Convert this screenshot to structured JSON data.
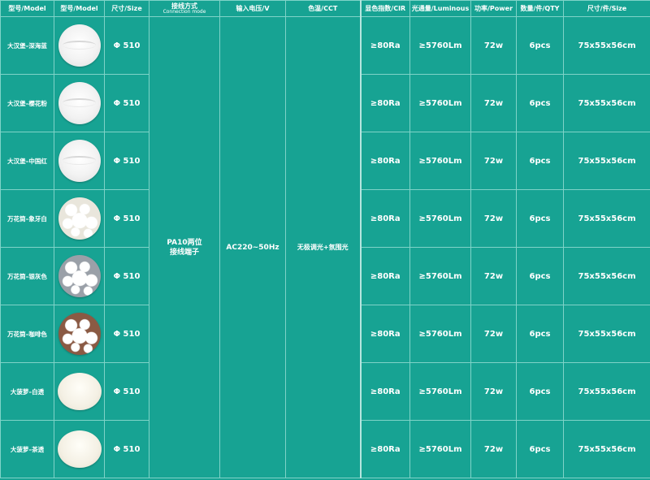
{
  "headers": {
    "model1": "型号/Model",
    "model2": "型号/Model",
    "size": "尺寸/Size",
    "connection": "接线方式",
    "connection_sub": "Connection mode",
    "voltage": "输入电压/V",
    "cct": "色温/CCT",
    "cri": "显色指数/CIR",
    "luminous": "光通量/Luminous",
    "power": "功率/Power",
    "qty": "数量/件/QTY",
    "pack_size": "尺寸/件/Size"
  },
  "merged": {
    "connection": "PA10两位\n接线端子",
    "voltage": "AC220~50Hz",
    "cct": "无极调光+氛围光"
  },
  "rows": [
    {
      "model": "大汉堡–深海蓝",
      "image": "plain",
      "size": "Φ 510",
      "cri": "≥80Ra",
      "luminous": "≥5760Lm",
      "power": "72w",
      "qty": "6pcs",
      "pack": "75x55x56cm"
    },
    {
      "model": "大汉堡–樱花粉",
      "image": "plain",
      "size": "Φ 510",
      "cri": "≥80Ra",
      "luminous": "≥5760Lm",
      "power": "72w",
      "qty": "6pcs",
      "pack": "75x55x56cm"
    },
    {
      "model": "大汉堡–中国红",
      "image": "plain",
      "size": "Φ 510",
      "cri": "≥80Ra",
      "luminous": "≥5760Lm",
      "power": "72w",
      "qty": "6pcs",
      "pack": "75x55x56cm"
    },
    {
      "model": "万花筒–象牙白",
      "image": "flower-ivory",
      "size": "Φ 510",
      "cri": "≥80Ra",
      "luminous": "≥5760Lm",
      "power": "72w",
      "qty": "6pcs",
      "pack": "75x55x56cm"
    },
    {
      "model": "万花筒–银灰色",
      "image": "flower-silver",
      "size": "Φ 510",
      "cri": "≥80Ra",
      "luminous": "≥5760Lm",
      "power": "72w",
      "qty": "6pcs",
      "pack": "75x55x56cm"
    },
    {
      "model": "万花筒–咖啡色",
      "image": "flower-coffee",
      "size": "Φ 510",
      "cri": "≥80Ra",
      "luminous": "≥5760Lm",
      "power": "72w",
      "qty": "6pcs",
      "pack": "75x55x56cm"
    },
    {
      "model": "大菠萝–白透",
      "image": "dome",
      "size": "Φ 510",
      "cri": "≥80Ra",
      "luminous": "≥5760Lm",
      "power": "72w",
      "qty": "6pcs",
      "pack": "75x55x56cm"
    },
    {
      "model": "大菠萝–茶透",
      "image": "dome",
      "size": "Φ 510",
      "cri": "≥80Ra",
      "luminous": "≥5760Lm",
      "power": "72w",
      "qty": "6pcs",
      "pack": "75x55x56cm"
    }
  ],
  "colors": {
    "background": "#17a393",
    "grid": "#7fd3c8",
    "text": "#ffffff"
  }
}
